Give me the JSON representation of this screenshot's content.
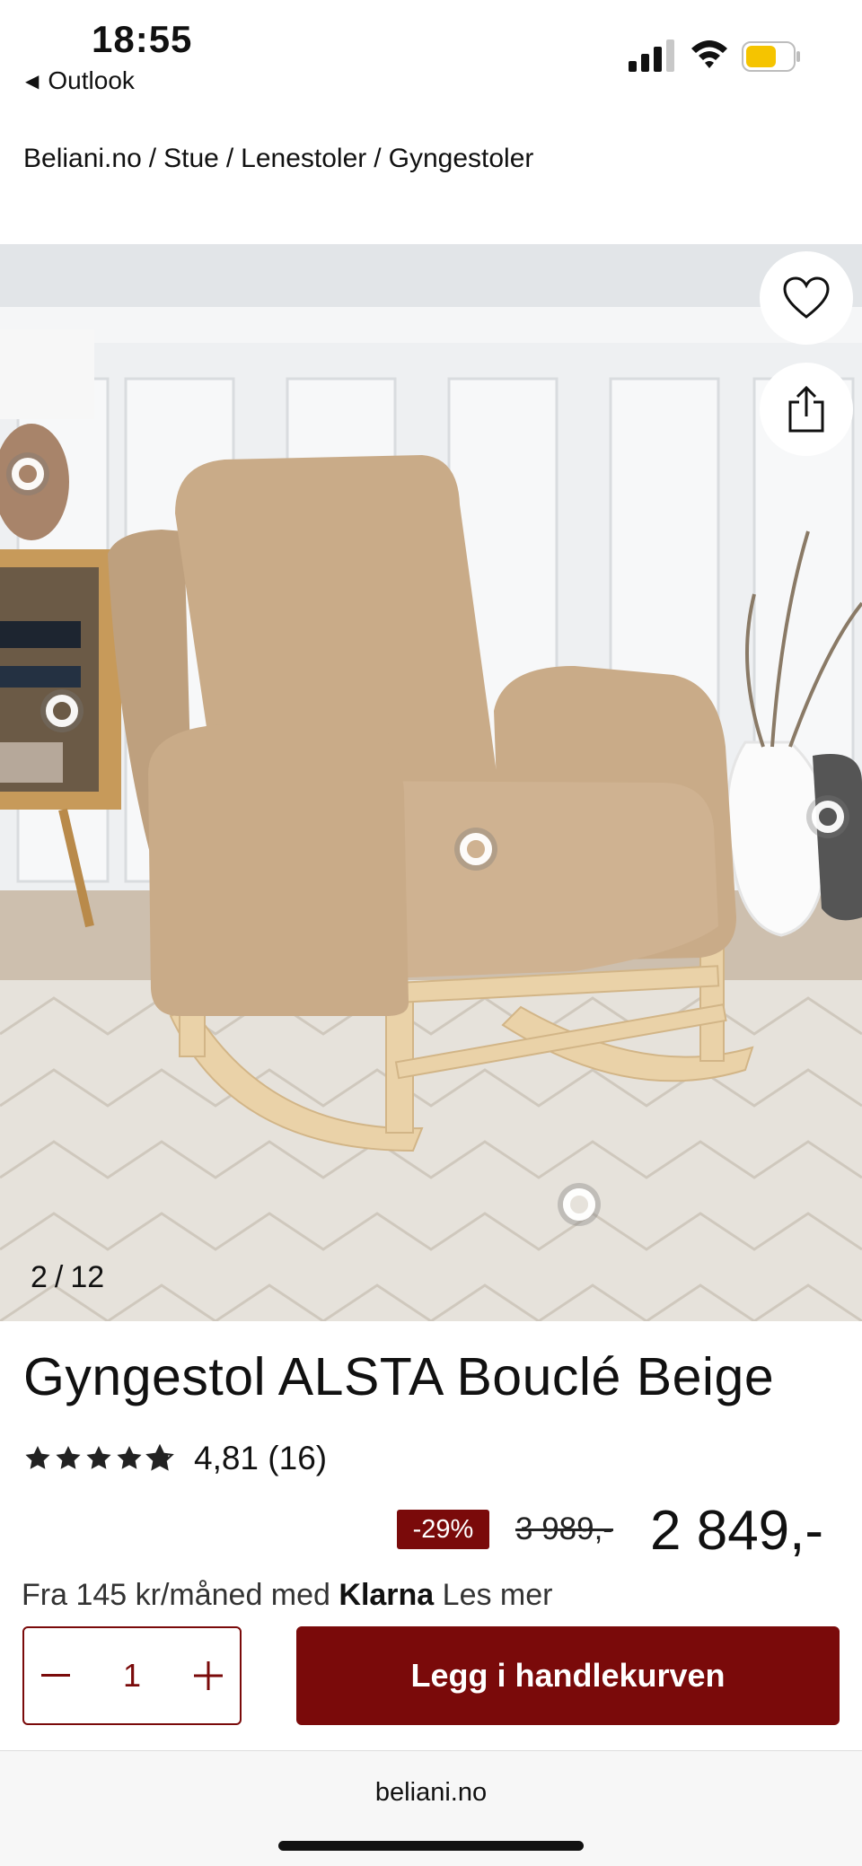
{
  "status_bar": {
    "time": "18:55",
    "back_app": "Outlook",
    "battery_color": "#f5c400"
  },
  "breadcrumb": [
    "Beliani.no",
    "Stue",
    "Lenestoler",
    "Gyngestoler"
  ],
  "gallery": {
    "current": "2",
    "total": "12",
    "favorite_icon": "heart-icon",
    "share_icon": "share-icon"
  },
  "product": {
    "title": "Gyngestol ALSTA Bouclé Beige",
    "rating_value": "4,81",
    "rating_count": "(16)",
    "stars": 4.81,
    "discount": "-29%",
    "old_price": "3 989,-",
    "price": "2 849,-",
    "klarna_prefix": "Fra 145 kr/måned med ",
    "klarna_brand": "Klarna",
    "klarna_link": " Les mer"
  },
  "cart": {
    "quantity": "1",
    "add_label": "Legg i handlekurven"
  },
  "browser": {
    "url": "beliani.no"
  },
  "colors": {
    "brand": "#7a0a0a"
  }
}
